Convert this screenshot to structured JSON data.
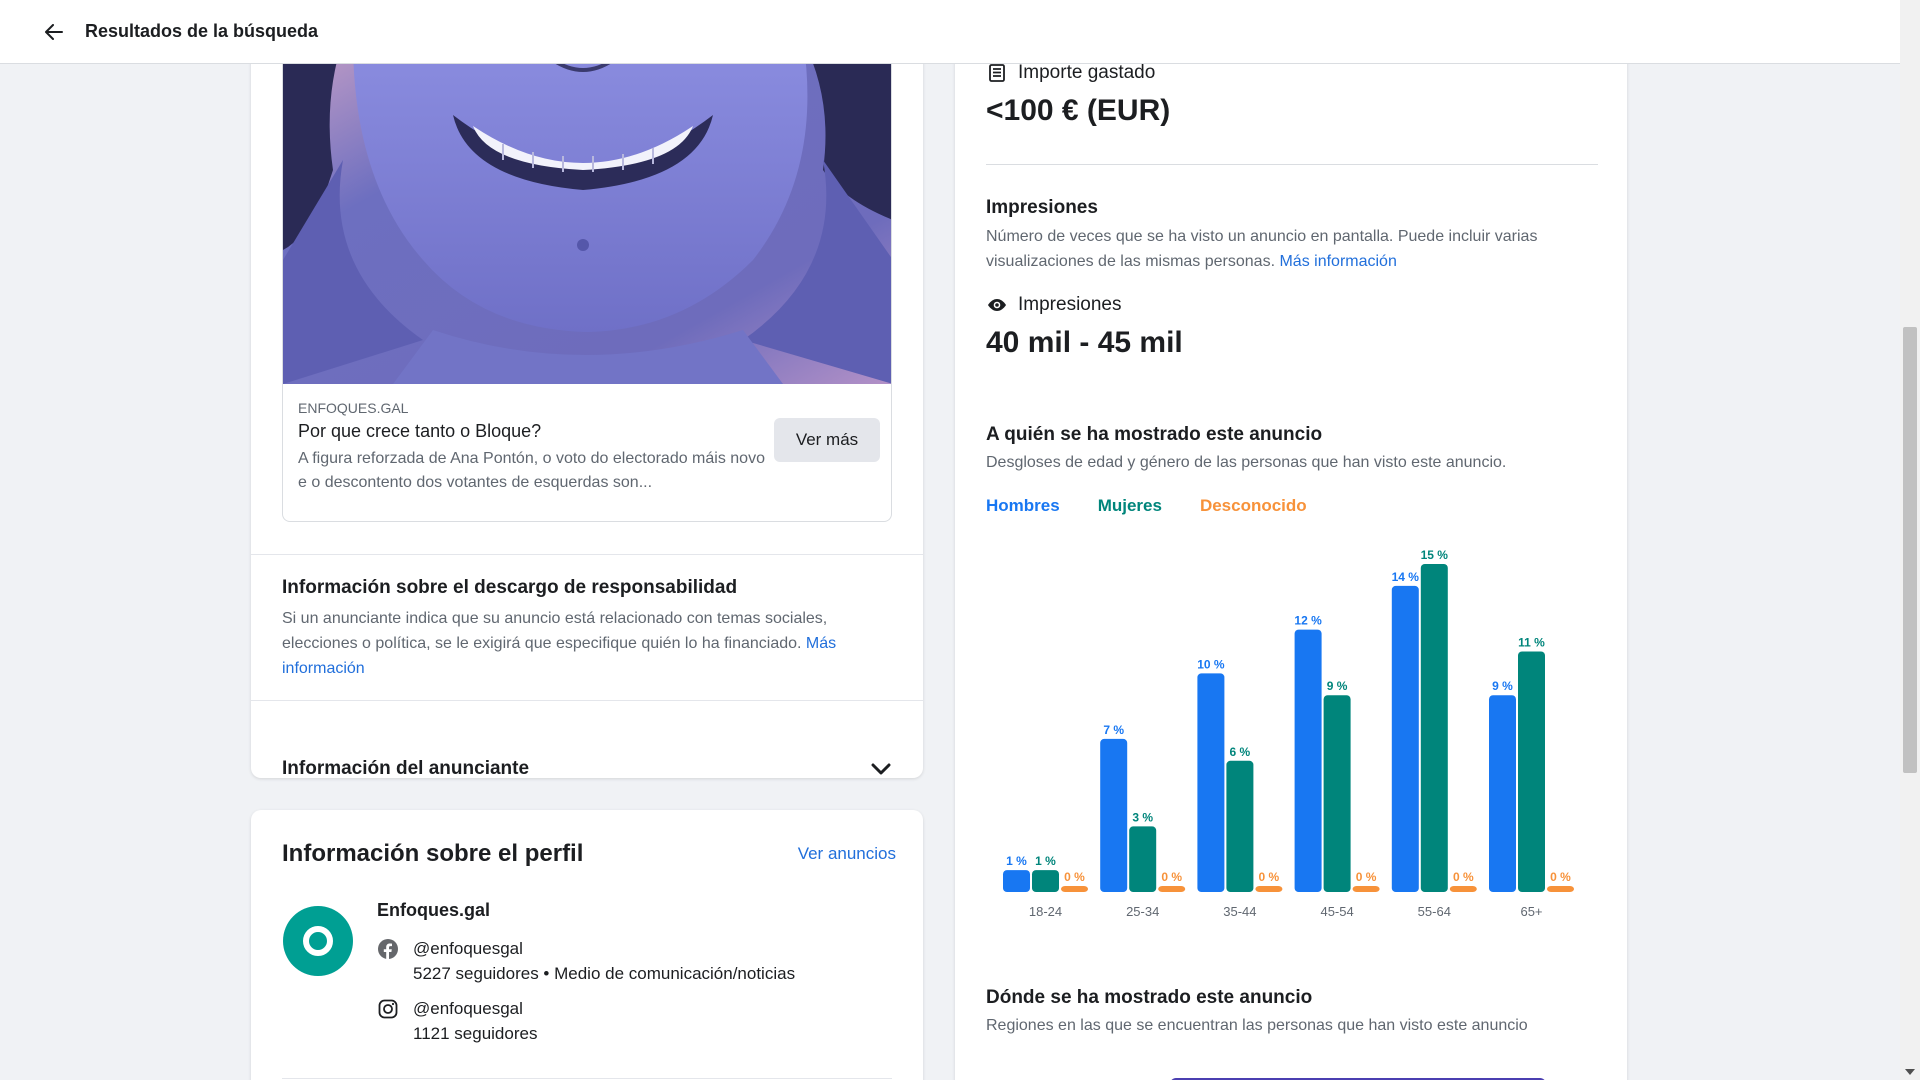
{
  "header": {
    "title": "Resultados de la búsqueda"
  },
  "ad": {
    "domain": "ENFOQUES.GAL",
    "title": "Por que crece tanto o Bloque?",
    "description": "A figura reforzada de Ana Pontón, o voto do electorado máis novo e o descontento dos votantes de esquerdas son...",
    "cta": "Ver más"
  },
  "disclaimer": {
    "title": "Información sobre el descargo de responsabilidad",
    "text": "Si un anunciante indica que su anuncio está relacionado con temas sociales, elecciones o política, se le exigirá que especifique quién lo ha financiado.",
    "link": "Más información"
  },
  "advertiser": {
    "title": "Información del anunciante"
  },
  "profile": {
    "title": "Información sobre el perfil",
    "link": "Ver anuncios",
    "name": "Enfoques.gal",
    "facebook": {
      "handle": "@enfoquesgal",
      "details": "5227 seguidores • Medio de comunicación/noticias"
    },
    "instagram": {
      "handle": "@enfoquesgal",
      "details": "1121 seguidores"
    }
  },
  "spend": {
    "label": "Importe gastado",
    "value": "<100 € (EUR)"
  },
  "impressions": {
    "title": "Impresiones",
    "desc": "Número de veces que se ha visto un anuncio en pantalla. Puede incluir varias visualizaciones de las mismas personas.",
    "link": "Más información",
    "label": "Impresiones",
    "value": "40 mil - 45 mil"
  },
  "audience": {
    "title": "A quién se ha mostrado este anuncio",
    "desc": "Desgloses de edad y género de las personas que han visto este anuncio."
  },
  "regions": {
    "title": "Dónde se ha mostrado este anuncio",
    "desc": "Regiones en las que se encuentran las personas que han visto este anuncio"
  },
  "colors": {
    "men": "#1877f2",
    "women": "#00857b",
    "unknown": "#f7923a",
    "link": "#216fdb"
  },
  "chart_data": {
    "type": "bar",
    "categories": [
      "18-24",
      "25-34",
      "35-44",
      "45-54",
      "55-64",
      "65+"
    ],
    "series": [
      {
        "name": "Hombres",
        "values": [
          1,
          7,
          10,
          12,
          14,
          9
        ]
      },
      {
        "name": "Mujeres",
        "values": [
          1,
          3,
          6,
          9,
          15,
          11
        ]
      },
      {
        "name": "Desconocido",
        "values": [
          0,
          0,
          0,
          0,
          0,
          0
        ]
      }
    ],
    "value_suffix": " %",
    "ylim": [
      0,
      15
    ],
    "grid": false,
    "legend": "top-left"
  }
}
